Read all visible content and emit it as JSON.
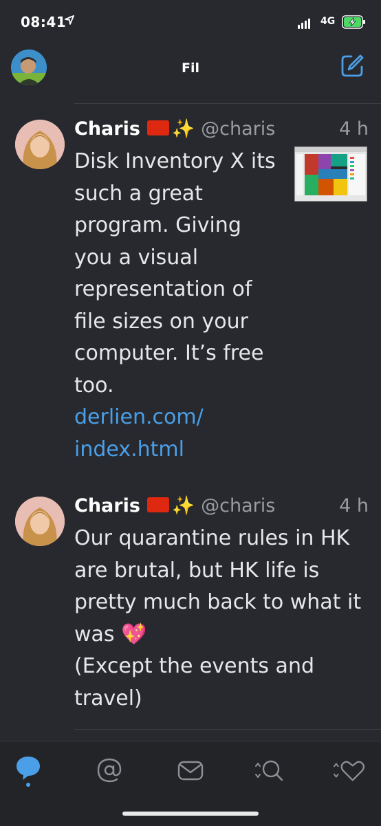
{
  "status_bar": {
    "time": "08:41",
    "network": "4G"
  },
  "nav": {
    "title": "Fil"
  },
  "tweets": [
    {
      "name": "Charis",
      "handle": "@charis",
      "time": "4 h",
      "text": "Disk Inventory X its\nsuch a great\nprogram. Giving\nyou a visual\nrepresentation of\nfile sizes on your\ncomputer. It’s free\ntoo.",
      "link": "derlien.com/\nindex.html"
    },
    {
      "name": "Charis",
      "handle": "@charis",
      "time": "4 h",
      "text": "Our quarantine rules in HK\nare brutal, but HK life is\npretty much back to what it\nwas 💖\n(Except the events and\ntravel)"
    }
  ],
  "tabs": [
    {
      "icon": "timeline-bubble-icon",
      "active": true
    },
    {
      "icon": "mentions-icon",
      "active": false
    },
    {
      "icon": "messages-icon",
      "active": false
    },
    {
      "icon": "search-icon",
      "active": false
    },
    {
      "icon": "likes-icon",
      "active": false
    }
  ],
  "colors": {
    "background": "#27292e",
    "accent": "#4a9fe8",
    "muted": "#9a9ca1"
  }
}
